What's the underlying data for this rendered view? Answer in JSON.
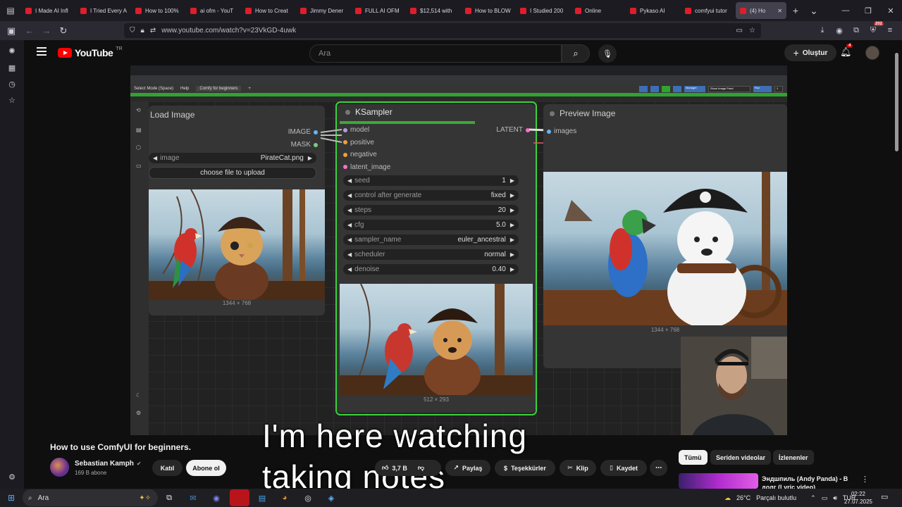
{
  "browser": {
    "tabs": [
      {
        "label": "I Made AI Infl",
        "active": false
      },
      {
        "label": "I Tried Every A",
        "active": false
      },
      {
        "label": "How to 100%",
        "active": false
      },
      {
        "label": "ai ofm - YouT",
        "active": false
      },
      {
        "label": "How to Creat",
        "active": false
      },
      {
        "label": "Jimmy Dener",
        "active": false
      },
      {
        "label": "FULL AI OFM",
        "active": false
      },
      {
        "label": "$12,514 with",
        "active": false
      },
      {
        "label": "How to BLOW",
        "active": false
      },
      {
        "label": "I Studied 200",
        "active": false
      },
      {
        "label": "Online",
        "active": false
      },
      {
        "label": "Pykaso AI",
        "active": false
      },
      {
        "label": "comfyui tutor",
        "active": false
      },
      {
        "label": "(4) Ho",
        "active": true
      }
    ],
    "url": "www.youtube.com/watch?v=23VkGD-4uwk",
    "extension_badge": "202"
  },
  "youtube": {
    "logo_text": "YouTube",
    "region": "TR",
    "search_placeholder": "Ara",
    "create_label": "Oluştur",
    "notification_count": "4"
  },
  "comfy": {
    "menu_mode": "Select Mode (Space)",
    "menu_help": "Help",
    "menu_tab": "Comfy for beginners",
    "manager_label": "Manager",
    "show_image_feed": "Show Image Feed",
    "run_label": "Run",
    "run_count": "1",
    "load_image": {
      "title": "Load Image",
      "out_image": "IMAGE",
      "out_mask": "MASK",
      "image_label": "image",
      "image_value": "PirateCat.png",
      "upload_label": "choose file to upload",
      "caption": "1344 × 768"
    },
    "ksampler": {
      "title": "KSampler",
      "inputs": [
        "model",
        "positive",
        "negative",
        "latent_image"
      ],
      "output": "LATENT",
      "widgets": [
        {
          "label": "seed",
          "value": "1"
        },
        {
          "label": "control after generate",
          "value": "fixed"
        },
        {
          "label": "steps",
          "value": "20"
        },
        {
          "label": "cfg",
          "value": "5.0"
        },
        {
          "label": "sampler_name",
          "value": "euler_ancestral"
        },
        {
          "label": "scheduler",
          "value": "normal"
        },
        {
          "label": "denoise",
          "value": "0.40"
        }
      ],
      "caption": "512 × 293"
    },
    "preview_image": {
      "title": "Preview Image",
      "input": "images",
      "caption": "1344 × 768"
    }
  },
  "subtitles": [
    "I'm here watching",
    "taking notes"
  ],
  "video": {
    "title": "How to use ComfyUI for beginners.",
    "channel": "Sebastian Kamph",
    "subscribers": "169 B abone",
    "join_label": "Katıl",
    "subscribe_label": "Abone ol",
    "likes": "3,7 B",
    "share_label": "Paylaş",
    "thanks_label": "Teşekkürler",
    "clip_label": "Klip",
    "save_label": "Kaydet"
  },
  "recommendations": {
    "chips": [
      "Tümü",
      "Seriden videolar",
      "İzlenenler"
    ],
    "first_title": "Эндшпиль (Andy Panda) - В долг (Lyric video)"
  },
  "taskbar": {
    "search_placeholder": "Ara",
    "weather": "26°C",
    "weather_desc": "Parçalı bulutlu",
    "language": "TUR",
    "time": "02:22",
    "date": "27.07.2025"
  },
  "colors": {
    "youtube_red": "#ff0000",
    "comfy_green": "#3cd13c",
    "slot_model": "#b39ddb",
    "slot_conditioning": "#f0a03c",
    "slot_latent": "#ff6ec7",
    "slot_image": "#64b5f6"
  }
}
